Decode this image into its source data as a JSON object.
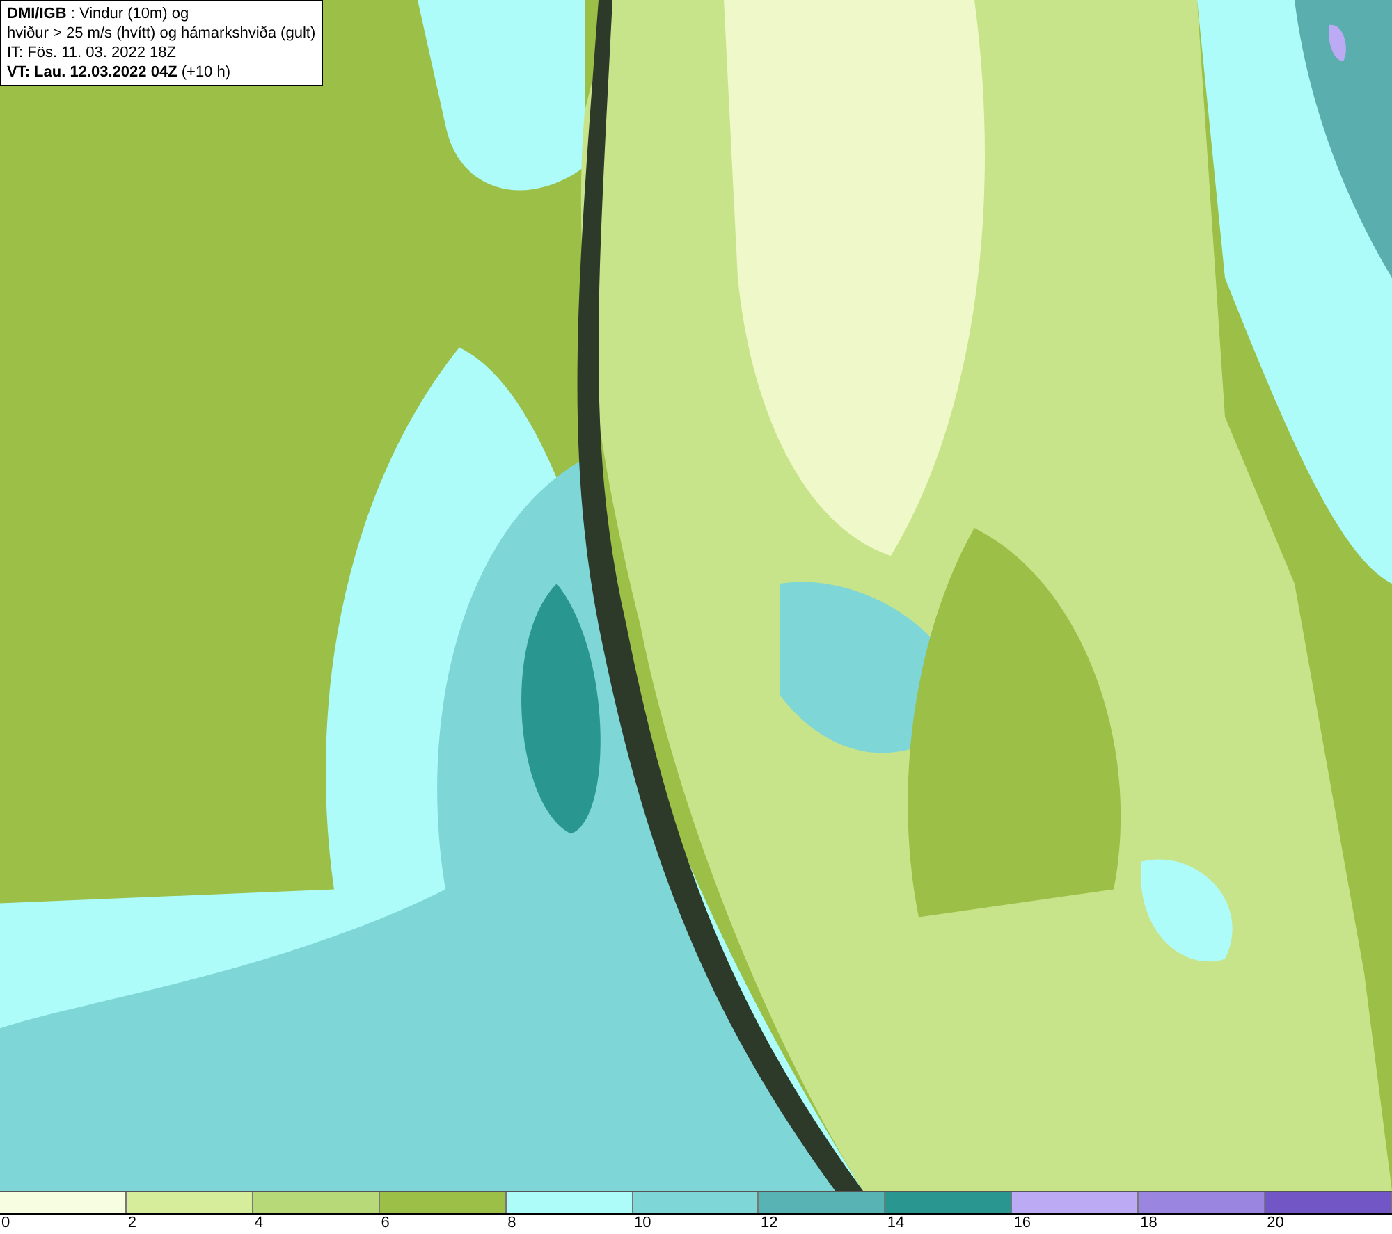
{
  "info_box": {
    "lines": [
      "**DMI/IGB** : Vindur (10m) og",
      "hviður > 25 m/s (hvítt) og hámarkshviða (gult)",
      "IT: Fös. 11. 03. 2022 18Z",
      "**VT: Lau. 12.03.2022 04Z** (+10 h)"
    ]
  },
  "legend": {
    "bins": [
      {
        "color": "#f7fde0"
      },
      {
        "color": "#d6ee9c"
      },
      {
        "color": "#b8d978"
      },
      {
        "color": "#9bbf47"
      },
      {
        "color": "#aefcfa"
      },
      {
        "color": "#7fd6d6"
      },
      {
        "color": "#58b4b4"
      },
      {
        "color": "#2a9690"
      },
      {
        "color": "#bcaaf5"
      },
      {
        "color": "#9a85e0"
      },
      {
        "color": "#7356c6"
      }
    ],
    "ticks": [
      "0",
      "2",
      "4",
      "6",
      "8",
      "10",
      "12",
      "14",
      "16",
      "18",
      "20"
    ]
  }
}
